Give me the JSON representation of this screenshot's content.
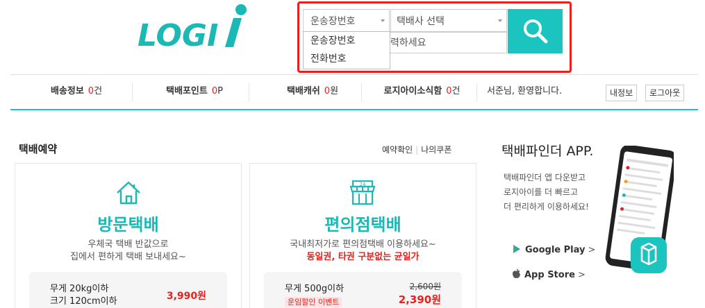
{
  "logo": {
    "text": "LOGI",
    "accent_letter": "i",
    "brand_color": "#1cb8b5"
  },
  "search": {
    "waybill_select": "운송장번호",
    "courier_select": "택배사 선택",
    "input_placeholder_visible": "력하세요",
    "dropdown_options": [
      "운송장번호",
      "전화번호"
    ],
    "button_icon": "search-icon",
    "highlight_color": "#e8201b",
    "button_color": "#1cc4c0"
  },
  "nav": {
    "items": [
      {
        "label": "배송정보",
        "value": "0",
        "unit": "건"
      },
      {
        "label": "택배포인트",
        "value": "0",
        "unit": "P"
      },
      {
        "label": "택배캐쉬",
        "value": "0",
        "unit": "원"
      },
      {
        "label": "로지아이소식함",
        "value": "0",
        "unit": "건"
      }
    ],
    "greeting": "서준님, 환영합니다.",
    "my_info": "내정보",
    "logout": "로그아웃"
  },
  "reservation": {
    "title": "택배예약",
    "link_confirm": "예약확인",
    "link_coupon": "나의쿠폰",
    "cards": [
      {
        "icon": "house-icon",
        "title": "방문택배",
        "desc_line1": "우체국 택배 반값으로",
        "desc_line2": "집에서 편하게 택배 보내세요~",
        "cond1": "무게 20kg이하",
        "cond2": "크기 120cm이하",
        "price": "3,990원"
      },
      {
        "icon": "store-icon",
        "title": "편의점택배",
        "desc_line1": "국내최저가로 편의점택배 이용하세요~",
        "desc_line2": "동일권, 타권 구분없는 균일가",
        "cond1": "무게 500g이하",
        "event": "운임할인 이벤트",
        "old_price": "2,600원",
        "price": "2,390원"
      }
    ]
  },
  "app": {
    "title": "택배파인더 APP.",
    "desc": [
      "택배파인더 앱 다운받고",
      "로지아이를 더 빠르고",
      "더 편리하게 이용하세요!"
    ],
    "google_play": "Google Play",
    "app_store": "App Store",
    "arrow": ">"
  }
}
